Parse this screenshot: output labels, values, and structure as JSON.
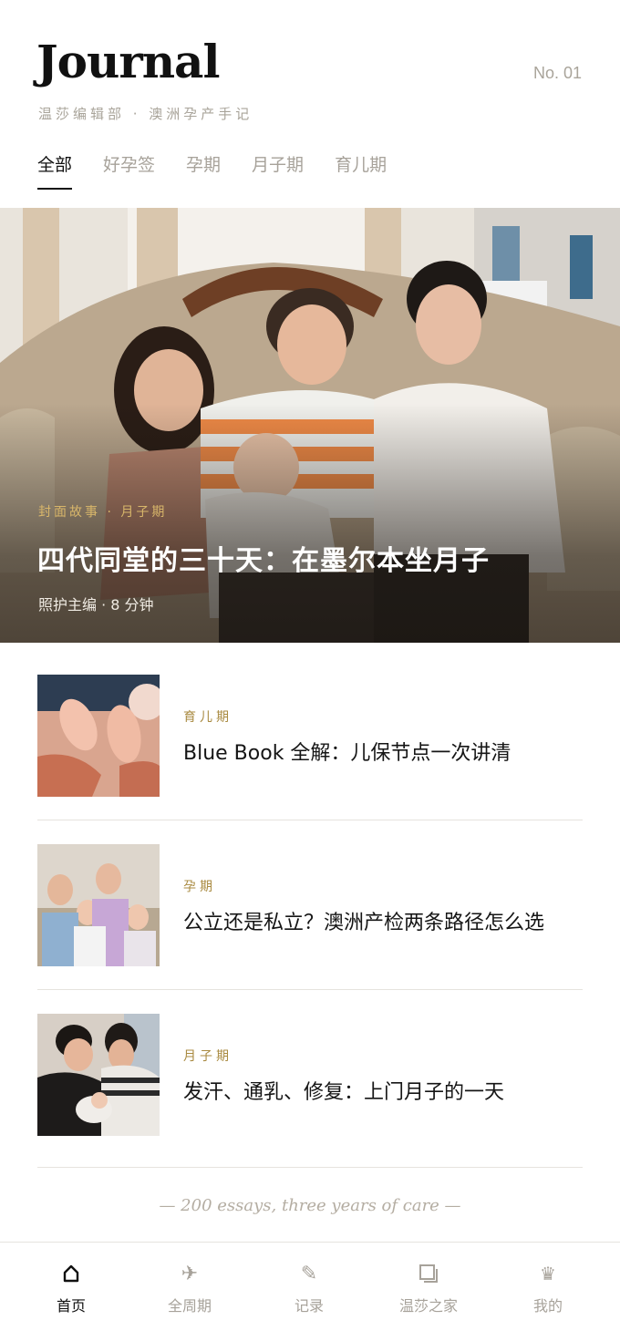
{
  "header": {
    "brand": "Journal",
    "issue": "No. 01",
    "subtitle": "温莎编辑部 · 澳洲孕产手记"
  },
  "tabs": [
    {
      "label": "全部",
      "active": true
    },
    {
      "label": "好孕签",
      "active": false
    },
    {
      "label": "孕期",
      "active": false
    },
    {
      "label": "月子期",
      "active": false
    },
    {
      "label": "育儿期",
      "active": false
    }
  ],
  "hero": {
    "kicker": "封面故事 · 月子期",
    "title": "四代同堂的三十天：在墨尔本坐月子",
    "meta": "照护主编 · 8 分钟"
  },
  "articles": [
    {
      "category": "育儿期",
      "title": "Blue Book 全解：儿保节点一次讲清"
    },
    {
      "category": "孕期",
      "title": "公立还是私立？澳洲产检两条路径怎么选"
    },
    {
      "category": "月子期",
      "title": "发汗、通乳、修复：上门月子的一天"
    }
  ],
  "footer_note": "— 200 essays, three years of care —",
  "bottom_nav": [
    {
      "label": "首页",
      "icon": "home-icon",
      "active": true
    },
    {
      "label": "全周期",
      "icon": "airplane-icon",
      "active": false
    },
    {
      "label": "记录",
      "icon": "pencil-icon",
      "active": false
    },
    {
      "label": "温莎之家",
      "icon": "window-icon",
      "active": false
    },
    {
      "label": "我的",
      "icon": "crown-icon",
      "active": false
    }
  ],
  "colors": {
    "accent_gold": "#a8893f",
    "hero_kicker": "#d8b66a",
    "muted": "#a7a29a"
  }
}
